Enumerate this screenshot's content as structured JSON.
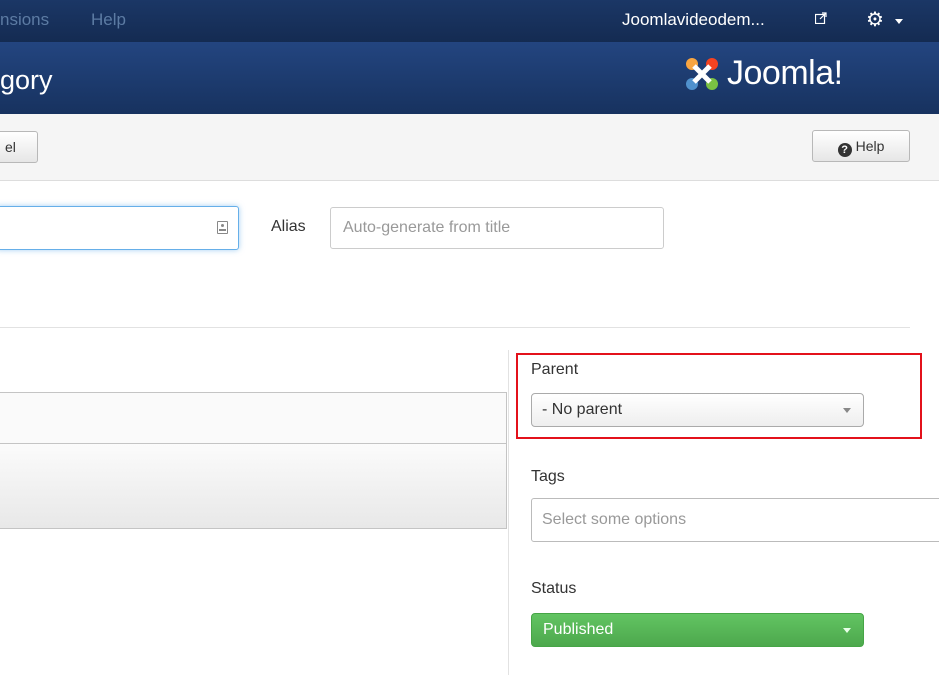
{
  "topbar": {
    "menu_partial": "nsions",
    "help": "Help",
    "site_name": "Joomlavideodem...",
    "external_icon": "external-link-icon",
    "settings_icon": "gear-icon"
  },
  "titlebar": {
    "title": "gory",
    "logo_text": "Joomla!"
  },
  "toolbar": {
    "cancel_label": "el",
    "help_label": "Help"
  },
  "form": {
    "title_value": "",
    "alias_label": "Alias",
    "alias_placeholder": "Auto-generate from title"
  },
  "sidebar": {
    "parent_label": "Parent",
    "parent_value": "- No parent",
    "tags_label": "Tags",
    "tags_placeholder": "Select some options",
    "status_label": "Status",
    "status_value": "Published"
  },
  "colors": {
    "navbar": "#17305a",
    "header": "#1a3867",
    "highlight": "#e3111b",
    "published": "#5bb75b"
  }
}
